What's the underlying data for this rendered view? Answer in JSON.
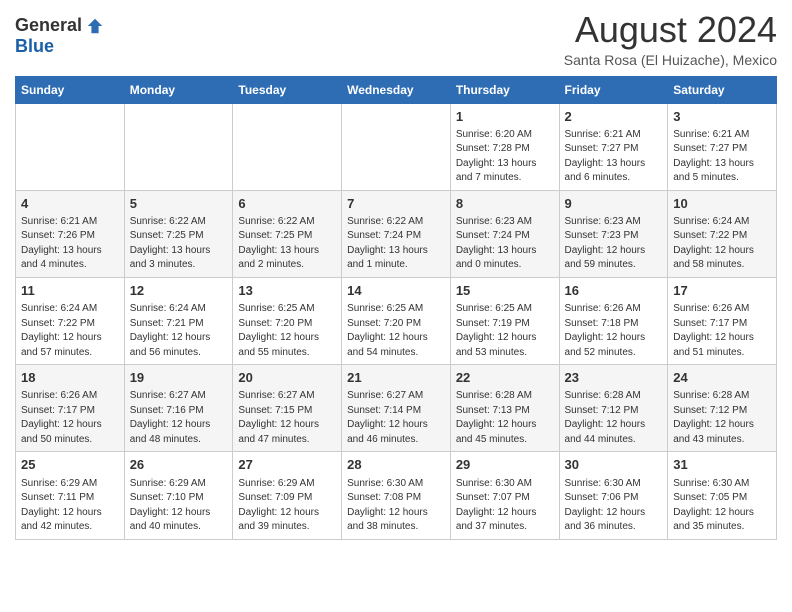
{
  "header": {
    "logo_general": "General",
    "logo_blue": "Blue",
    "month_title": "August 2024",
    "location": "Santa Rosa (El Huizache), Mexico"
  },
  "days_of_week": [
    "Sunday",
    "Monday",
    "Tuesday",
    "Wednesday",
    "Thursday",
    "Friday",
    "Saturday"
  ],
  "weeks": [
    [
      {
        "num": "",
        "info": ""
      },
      {
        "num": "",
        "info": ""
      },
      {
        "num": "",
        "info": ""
      },
      {
        "num": "",
        "info": ""
      },
      {
        "num": "1",
        "info": "Sunrise: 6:20 AM\nSunset: 7:28 PM\nDaylight: 13 hours\nand 7 minutes."
      },
      {
        "num": "2",
        "info": "Sunrise: 6:21 AM\nSunset: 7:27 PM\nDaylight: 13 hours\nand 6 minutes."
      },
      {
        "num": "3",
        "info": "Sunrise: 6:21 AM\nSunset: 7:27 PM\nDaylight: 13 hours\nand 5 minutes."
      }
    ],
    [
      {
        "num": "4",
        "info": "Sunrise: 6:21 AM\nSunset: 7:26 PM\nDaylight: 13 hours\nand 4 minutes."
      },
      {
        "num": "5",
        "info": "Sunrise: 6:22 AM\nSunset: 7:25 PM\nDaylight: 13 hours\nand 3 minutes."
      },
      {
        "num": "6",
        "info": "Sunrise: 6:22 AM\nSunset: 7:25 PM\nDaylight: 13 hours\nand 2 minutes."
      },
      {
        "num": "7",
        "info": "Sunrise: 6:22 AM\nSunset: 7:24 PM\nDaylight: 13 hours\nand 1 minute."
      },
      {
        "num": "8",
        "info": "Sunrise: 6:23 AM\nSunset: 7:24 PM\nDaylight: 13 hours\nand 0 minutes."
      },
      {
        "num": "9",
        "info": "Sunrise: 6:23 AM\nSunset: 7:23 PM\nDaylight: 12 hours\nand 59 minutes."
      },
      {
        "num": "10",
        "info": "Sunrise: 6:24 AM\nSunset: 7:22 PM\nDaylight: 12 hours\nand 58 minutes."
      }
    ],
    [
      {
        "num": "11",
        "info": "Sunrise: 6:24 AM\nSunset: 7:22 PM\nDaylight: 12 hours\nand 57 minutes."
      },
      {
        "num": "12",
        "info": "Sunrise: 6:24 AM\nSunset: 7:21 PM\nDaylight: 12 hours\nand 56 minutes."
      },
      {
        "num": "13",
        "info": "Sunrise: 6:25 AM\nSunset: 7:20 PM\nDaylight: 12 hours\nand 55 minutes."
      },
      {
        "num": "14",
        "info": "Sunrise: 6:25 AM\nSunset: 7:20 PM\nDaylight: 12 hours\nand 54 minutes."
      },
      {
        "num": "15",
        "info": "Sunrise: 6:25 AM\nSunset: 7:19 PM\nDaylight: 12 hours\nand 53 minutes."
      },
      {
        "num": "16",
        "info": "Sunrise: 6:26 AM\nSunset: 7:18 PM\nDaylight: 12 hours\nand 52 minutes."
      },
      {
        "num": "17",
        "info": "Sunrise: 6:26 AM\nSunset: 7:17 PM\nDaylight: 12 hours\nand 51 minutes."
      }
    ],
    [
      {
        "num": "18",
        "info": "Sunrise: 6:26 AM\nSunset: 7:17 PM\nDaylight: 12 hours\nand 50 minutes."
      },
      {
        "num": "19",
        "info": "Sunrise: 6:27 AM\nSunset: 7:16 PM\nDaylight: 12 hours\nand 48 minutes."
      },
      {
        "num": "20",
        "info": "Sunrise: 6:27 AM\nSunset: 7:15 PM\nDaylight: 12 hours\nand 47 minutes."
      },
      {
        "num": "21",
        "info": "Sunrise: 6:27 AM\nSunset: 7:14 PM\nDaylight: 12 hours\nand 46 minutes."
      },
      {
        "num": "22",
        "info": "Sunrise: 6:28 AM\nSunset: 7:13 PM\nDaylight: 12 hours\nand 45 minutes."
      },
      {
        "num": "23",
        "info": "Sunrise: 6:28 AM\nSunset: 7:12 PM\nDaylight: 12 hours\nand 44 minutes."
      },
      {
        "num": "24",
        "info": "Sunrise: 6:28 AM\nSunset: 7:12 PM\nDaylight: 12 hours\nand 43 minutes."
      }
    ],
    [
      {
        "num": "25",
        "info": "Sunrise: 6:29 AM\nSunset: 7:11 PM\nDaylight: 12 hours\nand 42 minutes."
      },
      {
        "num": "26",
        "info": "Sunrise: 6:29 AM\nSunset: 7:10 PM\nDaylight: 12 hours\nand 40 minutes."
      },
      {
        "num": "27",
        "info": "Sunrise: 6:29 AM\nSunset: 7:09 PM\nDaylight: 12 hours\nand 39 minutes."
      },
      {
        "num": "28",
        "info": "Sunrise: 6:30 AM\nSunset: 7:08 PM\nDaylight: 12 hours\nand 38 minutes."
      },
      {
        "num": "29",
        "info": "Sunrise: 6:30 AM\nSunset: 7:07 PM\nDaylight: 12 hours\nand 37 minutes."
      },
      {
        "num": "30",
        "info": "Sunrise: 6:30 AM\nSunset: 7:06 PM\nDaylight: 12 hours\nand 36 minutes."
      },
      {
        "num": "31",
        "info": "Sunrise: 6:30 AM\nSunset: 7:05 PM\nDaylight: 12 hours\nand 35 minutes."
      }
    ]
  ]
}
